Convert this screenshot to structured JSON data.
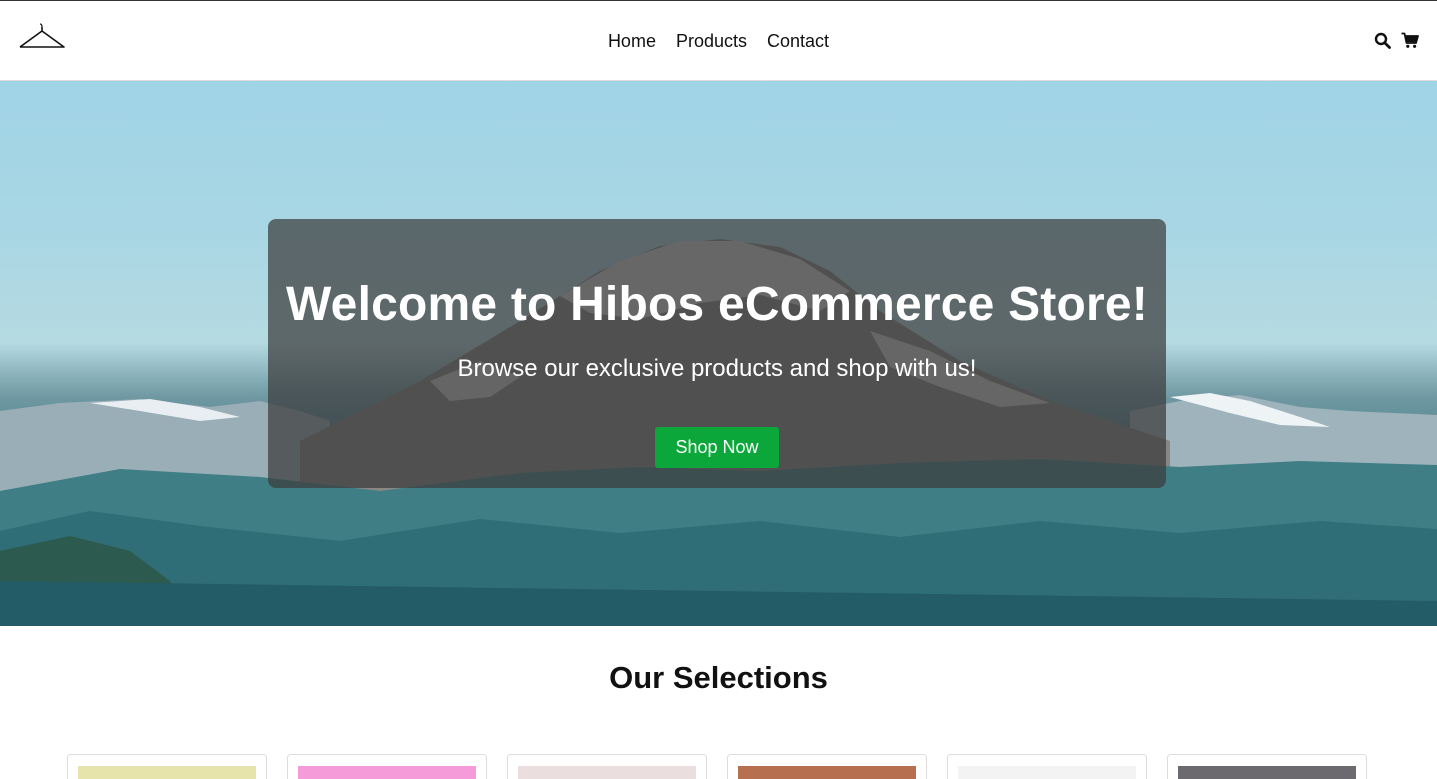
{
  "header": {
    "logo_icon": "hanger-icon",
    "nav": [
      {
        "label": "Home"
      },
      {
        "label": "Products"
      },
      {
        "label": "Contact"
      }
    ],
    "icons": [
      "search-icon",
      "cart-icon"
    ]
  },
  "hero": {
    "title": "Welcome to Hibos eCommerce Store!",
    "subtitle": "Browse our exclusive products and shop with us!",
    "cta_label": "Shop Now",
    "cta_color": "#0ca73a"
  },
  "selections": {
    "title": "Our Selections",
    "cards": [
      {
        "thumb_color": "#e6e4ab"
      },
      {
        "thumb_color": "#f59bd9"
      },
      {
        "thumb_color": "#eadede"
      },
      {
        "thumb_color": "#b7704f"
      },
      {
        "thumb_color": "#f3f3f3"
      },
      {
        "thumb_color": "#6d6a6f"
      }
    ]
  }
}
